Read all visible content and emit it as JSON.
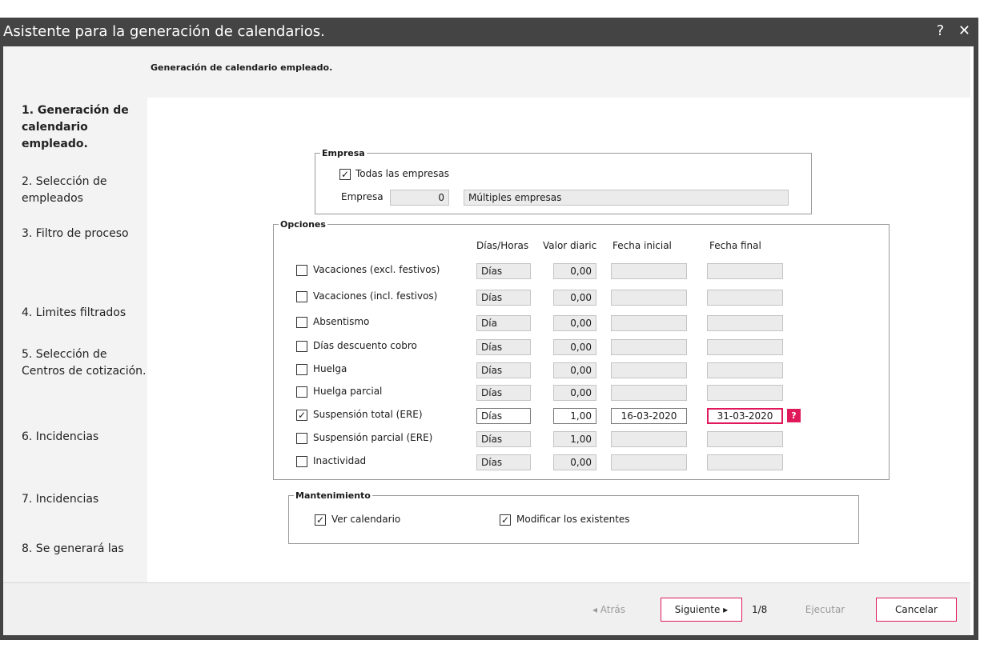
{
  "window": {
    "title": "Asistente para la generación de calendarios.",
    "help_glyph": "?",
    "close_glyph": "✕",
    "subtitle": "Generación de calendario empleado."
  },
  "steps": [
    {
      "label": "1. Generación de calendario empleado.",
      "active": true
    },
    {
      "label": "2. Selección de empleados"
    },
    {
      "label": "3. Filtro de proceso"
    },
    {
      "label": "4. Limites filtrados"
    },
    {
      "label": "5. Selección de Centros de cotización."
    },
    {
      "label": "6. Incidencias"
    },
    {
      "label": "7. Incidencias"
    },
    {
      "label": "8. Se generará las"
    }
  ],
  "empresa": {
    "legend": "Empresa",
    "todas_label": "Todas las empresas",
    "todas_checked": true,
    "field_label": "Empresa",
    "code": "0",
    "name": "Múltiples empresas"
  },
  "opciones": {
    "legend": "Opciones",
    "headers": {
      "dias_horas": "Días/Horas",
      "valor": "Valor diaric",
      "fecha_inicial": "Fecha inicial",
      "fecha_final": "Fecha final"
    },
    "rows": [
      {
        "label": "Vacaciones (excl. festivos)",
        "checked": false,
        "unit": "Días",
        "value": "0,00",
        "start": "",
        "end": ""
      },
      {
        "label": "Vacaciones (incl. festivos)",
        "checked": false,
        "unit": "Días",
        "value": "0,00",
        "start": "",
        "end": ""
      },
      {
        "label": "Absentismo",
        "checked": false,
        "unit": "Día",
        "value": "0,00",
        "start": "",
        "end": ""
      },
      {
        "label": "Días descuento cobro",
        "checked": false,
        "unit": "Días",
        "value": "0,00",
        "start": "",
        "end": ""
      },
      {
        "label": "Huelga",
        "checked": false,
        "unit": "Días",
        "value": "0,00",
        "start": "",
        "end": ""
      },
      {
        "label": "Huelga parcial",
        "checked": false,
        "unit": "Días",
        "value": "0,00",
        "start": "",
        "end": ""
      },
      {
        "label": "Suspensión total (ERE)",
        "checked": true,
        "unit": "Días",
        "value": "1,00",
        "start": "16-03-2020",
        "end": "31-03-2020",
        "error_icon": "?"
      },
      {
        "label": "Suspensión parcial (ERE)",
        "checked": false,
        "unit": "Días",
        "value": "1,00",
        "start": "",
        "end": ""
      },
      {
        "label": "Inactividad",
        "checked": false,
        "unit": "Días",
        "value": "0,00",
        "start": "",
        "end": ""
      }
    ]
  },
  "mantenimiento": {
    "legend": "Mantenimiento",
    "ver_label": "Ver calendario",
    "ver_checked": true,
    "modificar_label": "Modificar los existentes",
    "modificar_checked": true
  },
  "footer": {
    "atras": "◂  Atrás",
    "siguiente": "Siguiente ▸",
    "page": "1/8",
    "ejecutar": "Ejecutar",
    "cancelar": "Cancelar"
  },
  "colors": {
    "accent": "#e0195a",
    "titlebar": "#444444"
  }
}
